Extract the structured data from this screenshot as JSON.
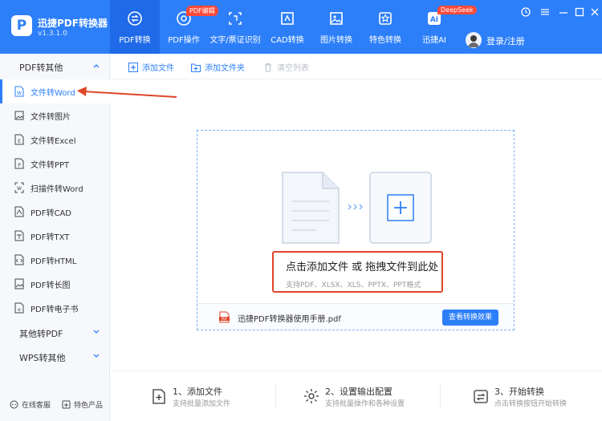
{
  "app": {
    "name": "迅捷PDF转换器",
    "version": "v1.3.1.0"
  },
  "nav": {
    "tabs": [
      {
        "label": "PDF转换",
        "icon": "convert-icon",
        "active": true
      },
      {
        "label": "PDF操作",
        "icon": "pdf-operate-icon",
        "badge": "PDF编辑"
      },
      {
        "label": "文字/票证识别",
        "icon": "ocr-icon"
      },
      {
        "label": "CAD转换",
        "icon": "cad-icon"
      },
      {
        "label": "图片转换",
        "icon": "image-icon"
      },
      {
        "label": "特色转换",
        "icon": "star-icon"
      },
      {
        "label": "迅捷AI",
        "icon": "ai-icon",
        "badge": "DeepSeek"
      }
    ],
    "login_label": "登录/注册"
  },
  "sidebar": {
    "group_main": "PDF转其他",
    "items": [
      {
        "label": "文件转Word",
        "icon": "word-icon",
        "active": true
      },
      {
        "label": "文件转图片",
        "icon": "picture-icon"
      },
      {
        "label": "文件转Excel",
        "icon": "excel-icon"
      },
      {
        "label": "文件转PPT",
        "icon": "ppt-icon"
      },
      {
        "label": "扫描件转Word",
        "icon": "scan-icon"
      },
      {
        "label": "PDF转CAD",
        "icon": "cad-file-icon"
      },
      {
        "label": "PDF转TXT",
        "icon": "txt-icon"
      },
      {
        "label": "PDF转HTML",
        "icon": "html-icon"
      },
      {
        "label": "PDF转长图",
        "icon": "long-image-icon"
      },
      {
        "label": "PDF转电子书",
        "icon": "ebook-icon"
      }
    ],
    "group_other_to_pdf": "其他转PDF",
    "group_wps": "WPS转其他",
    "footer_service": "在线客服",
    "footer_products": "特色产品"
  },
  "toolbar": {
    "add_file": "添加文件",
    "add_folder": "添加文件夹",
    "clear_list": "清空列表"
  },
  "dropzone": {
    "main_text": "点击添加文件 或 拖拽文件到此处",
    "sub_text": "支持PDF、XLSX、XLS、PPTX、PPT格式",
    "file_name": "迅捷PDF转换器使用手册.pdf",
    "view_button": "查看转换效果"
  },
  "steps": [
    {
      "title": "1、添加文件",
      "sub": "支持批量添加文件"
    },
    {
      "title": "2、设置输出配置",
      "sub": "支持批量操作和各种设置"
    },
    {
      "title": "3、开始转换",
      "sub": "点击转换按钮开始转换"
    }
  ],
  "colors": {
    "brand": "#2d7ff9",
    "highlight": "#e0452a",
    "badge": "#ff4a3a"
  }
}
